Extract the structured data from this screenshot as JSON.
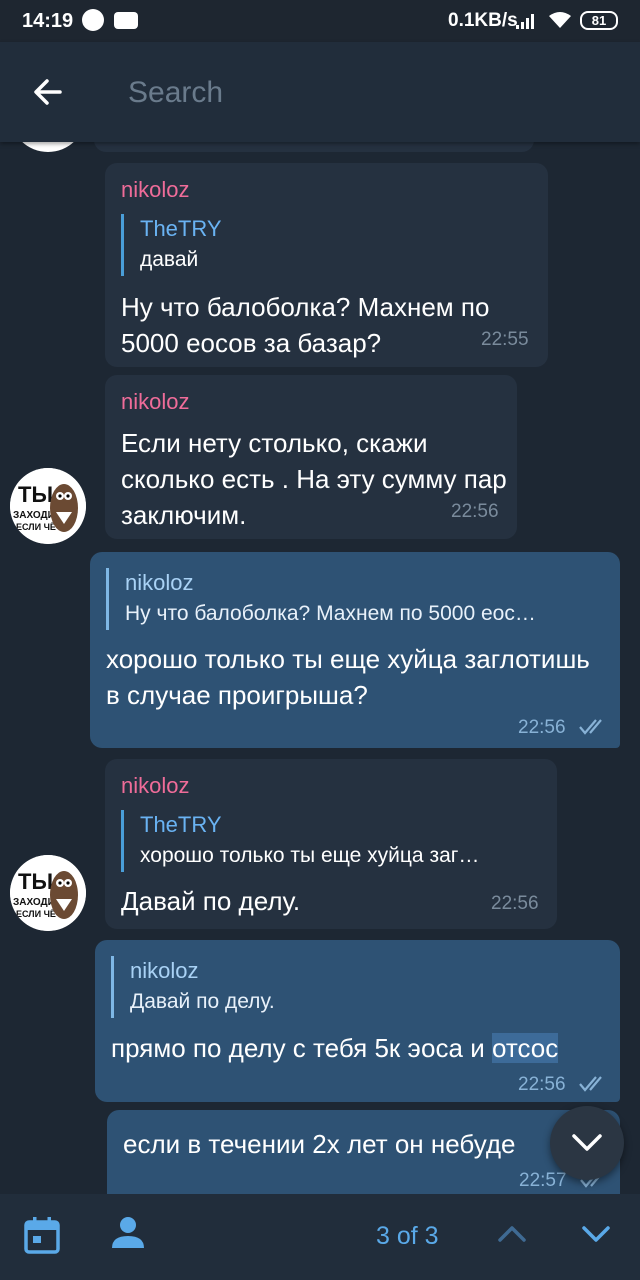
{
  "status_bar": {
    "time": "14:19",
    "network_speed": "0.1KB/s",
    "battery": "81"
  },
  "search": {
    "placeholder": "Search"
  },
  "messages": [
    {
      "direction": "in",
      "sender": "nikoloz",
      "reply_name": "TheTRY",
      "reply_text": "давай",
      "text": "Ну что балоболка? Махнем по 5000 еосов за базар?",
      "time": "22:55"
    },
    {
      "direction": "in",
      "sender": "nikoloz",
      "text": "Если нету столько, скажи сколько есть . На эту сумму пар заключим.",
      "time": "22:56"
    },
    {
      "direction": "out",
      "reply_name": "nikoloz",
      "reply_text": "Ну что балоболка? Махнем по 5000 еос…",
      "text": "хорошо только ты еще хуйца заглотишь в случае проигрыша?",
      "time": "22:56"
    },
    {
      "direction": "in",
      "sender": "nikoloz",
      "reply_name": "TheTRY",
      "reply_text": "хорошо только ты еще хуйца заг…",
      "text": "Давай по делу.",
      "time": "22:56"
    },
    {
      "direction": "out",
      "reply_name": "nikoloz",
      "reply_text": "Давай по делу.",
      "text_before": "прямо по делу с тебя 5к эоса и ",
      "text_highlight": "отсос",
      "time": "22:56"
    },
    {
      "direction": "out",
      "text": "если в течении 2х лет он небуде",
      "time": "22:57"
    }
  ],
  "bottom_bar": {
    "search_count": "3 of 3"
  },
  "colors": {
    "incoming_bubble": "#253140",
    "outgoing_bubble": "#2e5274",
    "sender_name": "#ef6c99",
    "accent": "#5aa9e8"
  }
}
